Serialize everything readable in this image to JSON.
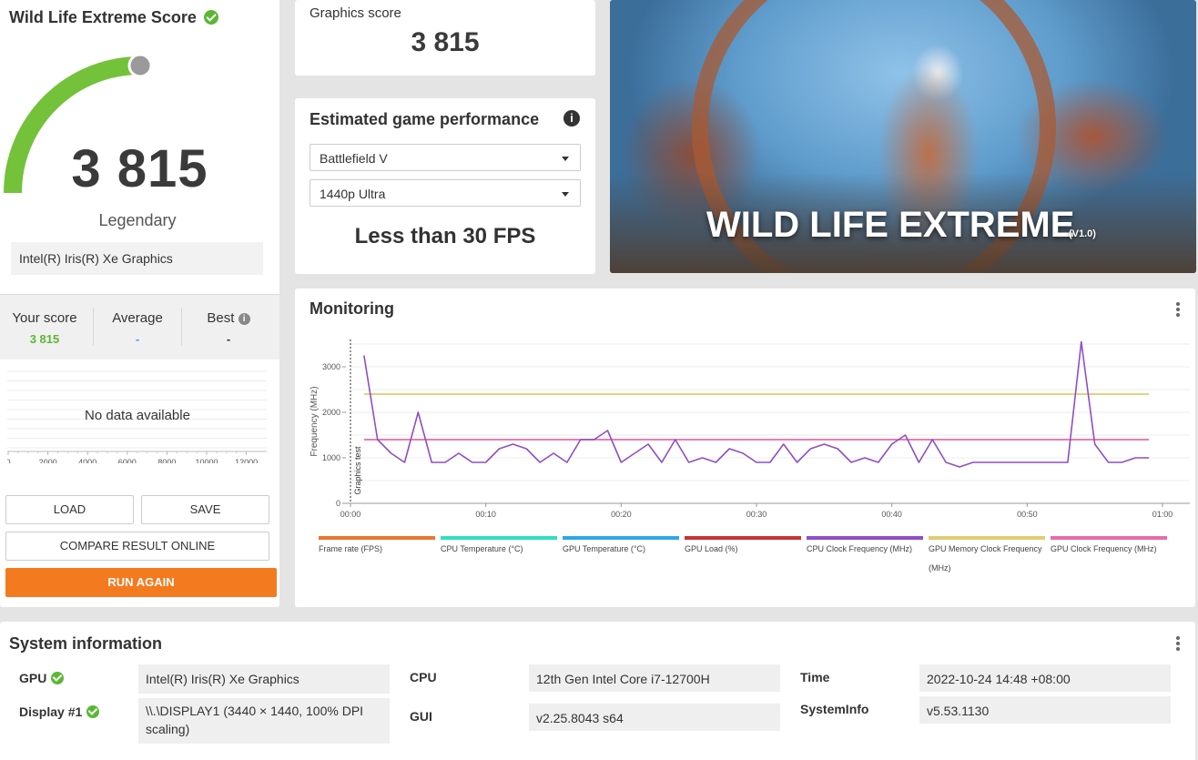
{
  "score_panel": {
    "title": "Wild Life Extreme Score",
    "score": "3 815",
    "score_fraction": 0.5,
    "rank": "Legendary",
    "gpu": "Intel(R) Iris(R) Xe Graphics",
    "your_score_label": "Your score",
    "your_score_value": "3 815",
    "average_label": "Average",
    "average_value": "-",
    "best_label": "Best",
    "best_value": "-",
    "no_data": "No data available",
    "hist_ticks": [
      "0",
      "2000",
      "4000",
      "6000",
      "8000",
      "10000",
      "12000"
    ],
    "load_label": "LOAD",
    "save_label": "SAVE",
    "compare_label": "COMPARE RESULT ONLINE",
    "run_label": "RUN AGAIN"
  },
  "graphics": {
    "label": "Graphics score",
    "value": "3 815"
  },
  "performance": {
    "title": "Estimated game performance",
    "info_icon": "i",
    "game": "Battlefield V",
    "preset": "1440p Ultra",
    "fps": "Less than 30 FPS"
  },
  "hero": {
    "title": "WILD LIFE EXTREME",
    "version": "(V1.0)"
  },
  "monitoring": {
    "title": "Monitoring"
  },
  "chart_data": {
    "type": "line",
    "ylabel": "Frequency (MHz)",
    "section_label": "Graphics test",
    "xlim": [
      0,
      60
    ],
    "ylim": [
      0,
      3600
    ],
    "x_ticks": [
      "00:00",
      "00:10",
      "00:20",
      "00:30",
      "00:40",
      "00:50",
      "01:00"
    ],
    "y_ticks": [
      0,
      1000,
      2000,
      3000
    ],
    "legend": [
      {
        "name": "Frame rate (FPS)",
        "color": "#e8772e"
      },
      {
        "name": "CPU Temperature (°C)",
        "color": "#2de0c0"
      },
      {
        "name": "GPU Temperature (°C)",
        "color": "#2ba8e8"
      },
      {
        "name": "GPU Load (%)",
        "color": "#c83232"
      },
      {
        "name": "CPU Clock Frequency (MHz)",
        "color": "#8e4ec6"
      },
      {
        "name": "GPU Memory Clock Frequency (MHz)",
        "color": "#e0cc70"
      },
      {
        "name": "GPU Clock Frequency (MHz)",
        "color": "#e86aa8"
      }
    ],
    "series": [
      {
        "name": "CPU Clock Frequency (MHz)",
        "color": "#8e4ec6",
        "x": [
          1,
          2,
          3,
          4,
          5,
          6,
          7,
          8,
          9,
          10,
          11,
          12,
          13,
          14,
          15,
          16,
          17,
          18,
          19,
          20,
          21,
          22,
          23,
          24,
          25,
          26,
          27,
          28,
          29,
          30,
          31,
          32,
          33,
          34,
          35,
          36,
          37,
          38,
          39,
          40,
          41,
          42,
          43,
          44,
          45,
          46,
          47,
          48,
          49,
          50,
          51,
          52,
          53,
          54,
          55,
          56,
          57,
          58,
          59
        ],
        "y": [
          3250,
          1400,
          1100,
          900,
          2000,
          900,
          900,
          1100,
          900,
          900,
          1200,
          1300,
          1200,
          900,
          1100,
          900,
          1400,
          1400,
          1600,
          900,
          1100,
          1300,
          900,
          1400,
          900,
          1000,
          900,
          1200,
          1100,
          900,
          900,
          1300,
          900,
          1200,
          1300,
          1200,
          900,
          1000,
          900,
          1300,
          1500,
          900,
          1400,
          900,
          800,
          900,
          900,
          900,
          900,
          900,
          900,
          900,
          900,
          3550,
          1300,
          900,
          900,
          1000,
          1000
        ]
      },
      {
        "name": "GPU Memory Clock Frequency (MHz)",
        "color": "#e0cc70",
        "x": [
          1,
          59
        ],
        "y": [
          2400,
          2400
        ]
      },
      {
        "name": "GPU Clock Frequency (MHz)",
        "color": "#e86aa8",
        "x": [
          1,
          59
        ],
        "y": [
          1400,
          1400
        ]
      }
    ]
  },
  "system": {
    "title": "System information",
    "gpu_label": "GPU",
    "gpu_value": "Intel(R) Iris(R) Xe Graphics",
    "display_label": "Display #1",
    "display_value": "\\\\.\\DISPLAY1 (3440 × 1440, 100% DPI scaling)",
    "cpu_label": "CPU",
    "cpu_value": "12th Gen Intel Core i7-12700H",
    "gui_label": "GUI",
    "gui_value": "v2.25.8043 s64",
    "time_label": "Time",
    "time_value": "2022-10-24 14:48 +08:00",
    "systeminfo_label": "SystemInfo",
    "systeminfo_value": "v5.53.1130"
  },
  "colors": {
    "accent_orange": "#f47a1f",
    "gauge_green": "#74c13a",
    "score_green": "#5bb733",
    "average_blue": "#2ba8e8"
  }
}
